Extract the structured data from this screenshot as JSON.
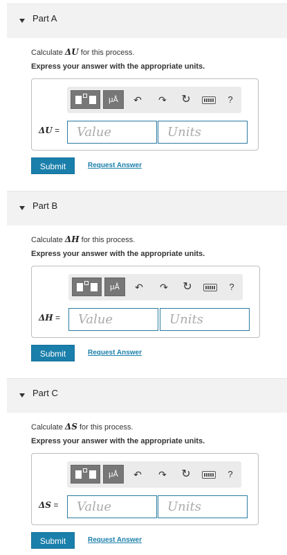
{
  "toolbar": {
    "units_label": "μÅ",
    "undo_glyph": "↶",
    "redo_glyph": "↷",
    "reset_glyph": "↻",
    "help_label": "?"
  },
  "parts": [
    {
      "title": "Part A",
      "prompt_prefix": "Calculate ",
      "symbol": "ΔU",
      "prompt_suffix": " for this process.",
      "instruction": "Express your answer with the appropriate units.",
      "eq_symbol": "ΔU",
      "eq_sign": " =",
      "value_placeholder": "Value",
      "units_placeholder": "Units",
      "submit_label": "Submit",
      "request_label": "Request Answer"
    },
    {
      "title": "Part B",
      "prompt_prefix": "Calculate ",
      "symbol": "ΔH",
      "prompt_suffix": " for this process.",
      "instruction": "Express your answer with the appropriate units.",
      "eq_symbol": "ΔH",
      "eq_sign": " =",
      "value_placeholder": "Value",
      "units_placeholder": "Units",
      "submit_label": "Submit",
      "request_label": "Request Answer"
    },
    {
      "title": "Part C",
      "prompt_prefix": "Calculate ",
      "symbol": "ΔS",
      "prompt_suffix": " for this process.",
      "instruction": "Express your answer with the appropriate units.",
      "eq_symbol": "ΔS",
      "eq_sign": " =",
      "value_placeholder": "Value",
      "units_placeholder": "Units",
      "submit_label": "Submit",
      "request_label": "Request Answer"
    }
  ],
  "colors": {
    "accent": "#1a7faa",
    "header_bg": "#f2f2f2",
    "field_border": "#2a7aa0"
  }
}
